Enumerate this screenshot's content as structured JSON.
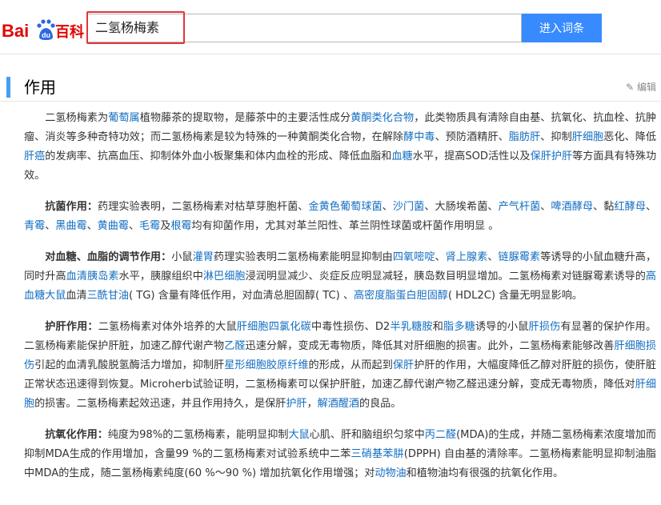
{
  "brand": {
    "logo_bai": "Bai",
    "logo_du": "du",
    "logo_baike": "百科"
  },
  "search": {
    "value": "二氢杨梅素",
    "button_label": "进入词条"
  },
  "section": {
    "title": "作用",
    "edit_label": "编辑"
  },
  "paragraphs": [
    [
      {
        "t": "二氢杨梅素为"
      },
      {
        "t": "葡萄属",
        "link": true
      },
      {
        "t": "植物藤茶的提取物，是藤茶中的主要活性成分"
      },
      {
        "t": "黄酮类化合物",
        "link": true
      },
      {
        "t": "，此类物质具有清除自由基、抗氧化、抗血栓、抗肿瘤、消炎等多种奇特功效；而二氢杨梅素是较为特殊的一种黄酮类化合物，在解除"
      },
      {
        "t": "酵中毒",
        "link": true
      },
      {
        "t": "、预防酒精肝、"
      },
      {
        "t": "脂肪肝",
        "link": true
      },
      {
        "t": "、抑制"
      },
      {
        "t": "肝细胞",
        "link": true
      },
      {
        "t": "恶化、降低"
      },
      {
        "t": "肝癌",
        "link": true
      },
      {
        "t": "的发病率、抗高血压、抑制体外血小板聚集和体内血栓的形成、降低血脂和"
      },
      {
        "t": "血糖",
        "link": true
      },
      {
        "t": "水平，提高SOD活性以及"
      },
      {
        "t": "保肝护肝",
        "link": true
      },
      {
        "t": "等方面具有特殊功效。"
      }
    ],
    [
      {
        "t": "抗菌作用：",
        "bold": true
      },
      {
        "t": "药理实验表明，二氢杨梅素对枯草芽胞杆菌、"
      },
      {
        "t": "金黄色葡萄球菌",
        "link": true
      },
      {
        "t": "、"
      },
      {
        "t": "沙门菌",
        "link": true
      },
      {
        "t": "、大肠埃希菌、"
      },
      {
        "t": "产气杆菌",
        "link": true
      },
      {
        "t": "、"
      },
      {
        "t": "啤酒酵母",
        "link": true
      },
      {
        "t": "、黏"
      },
      {
        "t": "红酵母",
        "link": true
      },
      {
        "t": "、"
      },
      {
        "t": "青霉",
        "link": true
      },
      {
        "t": "、"
      },
      {
        "t": "黑曲霉",
        "link": true
      },
      {
        "t": "、"
      },
      {
        "t": "黄曲霉",
        "link": true
      },
      {
        "t": "、"
      },
      {
        "t": "毛霉",
        "link": true
      },
      {
        "t": "及"
      },
      {
        "t": "根霉",
        "link": true
      },
      {
        "t": "均有抑菌作用，尤其对革兰阳性、革兰阴性球菌或杆菌作用明显 。"
      }
    ],
    [
      {
        "t": "对血糖、血脂的调节作用：",
        "bold": true
      },
      {
        "t": "小鼠"
      },
      {
        "t": "灌胃",
        "link": true
      },
      {
        "t": "药理实验表明二氢杨梅素能明显抑制由"
      },
      {
        "t": "四氧嘧啶",
        "link": true
      },
      {
        "t": "、"
      },
      {
        "t": "肾上腺素",
        "link": true
      },
      {
        "t": "、"
      },
      {
        "t": "链脲霉素",
        "link": true
      },
      {
        "t": "等诱导的小鼠血糖升高，同时升高"
      },
      {
        "t": "血清胰岛素",
        "link": true
      },
      {
        "t": "水平，胰腺组织中"
      },
      {
        "t": "淋巴细胞",
        "link": true
      },
      {
        "t": "浸润明显减少、炎症反应明显减轻，胰岛数目明显增加。二氢杨梅素对链脲霉素诱导的"
      },
      {
        "t": "高血糖大鼠",
        "link": true
      },
      {
        "t": "血清"
      },
      {
        "t": "三酰甘油",
        "link": true
      },
      {
        "t": "( TG) 含量有降低作用，对血清总胆固醇( TC) 、"
      },
      {
        "t": "高密度脂蛋白胆固醇",
        "link": true
      },
      {
        "t": "( HDL2C) 含量无明显影响。"
      }
    ],
    [
      {
        "t": "护肝",
        "link": true,
        "bold": true
      },
      {
        "t": "作用：",
        "bold": true
      },
      {
        "t": "二氢杨梅素对体外培养的大鼠"
      },
      {
        "t": "肝细胞",
        "link": true
      },
      {
        "t": "四氯化碳",
        "link": true
      },
      {
        "t": "中毒性损伤、D2"
      },
      {
        "t": "半乳糖胺",
        "link": true
      },
      {
        "t": "和"
      },
      {
        "t": "脂多糖",
        "link": true
      },
      {
        "t": "诱导的小鼠"
      },
      {
        "t": "肝损伤",
        "link": true
      },
      {
        "t": "有显著的保护作用。二氢杨梅素能保护肝脏，加速乙醇代谢产物"
      },
      {
        "t": "乙醛",
        "link": true
      },
      {
        "t": "迅速分解，变成无毒物质，降低其对肝细胞的损害。此外，二氢杨梅素能够改善"
      },
      {
        "t": "肝细胞损伤",
        "link": true
      },
      {
        "t": "引起的血清乳酸脱氢酶活力增加，抑制肝"
      },
      {
        "t": "星形细胞胶原纤维",
        "link": true
      },
      {
        "t": "的形成，从而起到"
      },
      {
        "t": "保肝",
        "link": true
      },
      {
        "t": "护肝的作用，大幅度降低乙醇对肝脏的损伤，使肝脏正常状态迅速得到恢复。Microherb试验证明，二氢杨梅素可以保护肝脏，加速乙醇代谢产物乙醛迅速分解，变成无毒物质，降低对"
      },
      {
        "t": "肝细胞",
        "link": true
      },
      {
        "t": "的损害。二氢杨梅素起效迅速，并且作用持久，是保肝"
      },
      {
        "t": "护肝",
        "link": true
      },
      {
        "t": "，"
      },
      {
        "t": "解酒醒酒",
        "link": true
      },
      {
        "t": "的良品。"
      }
    ],
    [
      {
        "t": "抗氧化作用：",
        "bold": true
      },
      {
        "t": "纯度为98%的二氢杨梅素，能明显抑制"
      },
      {
        "t": "大鼠",
        "link": true
      },
      {
        "t": "心肌、肝和脑组织匀浆中"
      },
      {
        "t": "丙二醛",
        "link": true
      },
      {
        "t": "(MDA)的生成，并随二氢杨梅素浓度增加而抑制MDA生成的作用增加，含量99 %的二氢杨梅素对试验系统中二苯"
      },
      {
        "t": "三硝基苯肼",
        "link": true
      },
      {
        "t": "(DPPH) 自由基的清除率。二氢杨梅素能明显抑制油脂中MDA的生成，随二氢杨梅素纯度(60 %～90 %) 增加抗氧化作用增强；对"
      },
      {
        "t": "动物油",
        "link": true
      },
      {
        "t": "和植物油均有很强的抗氧化作用。"
      }
    ]
  ]
}
